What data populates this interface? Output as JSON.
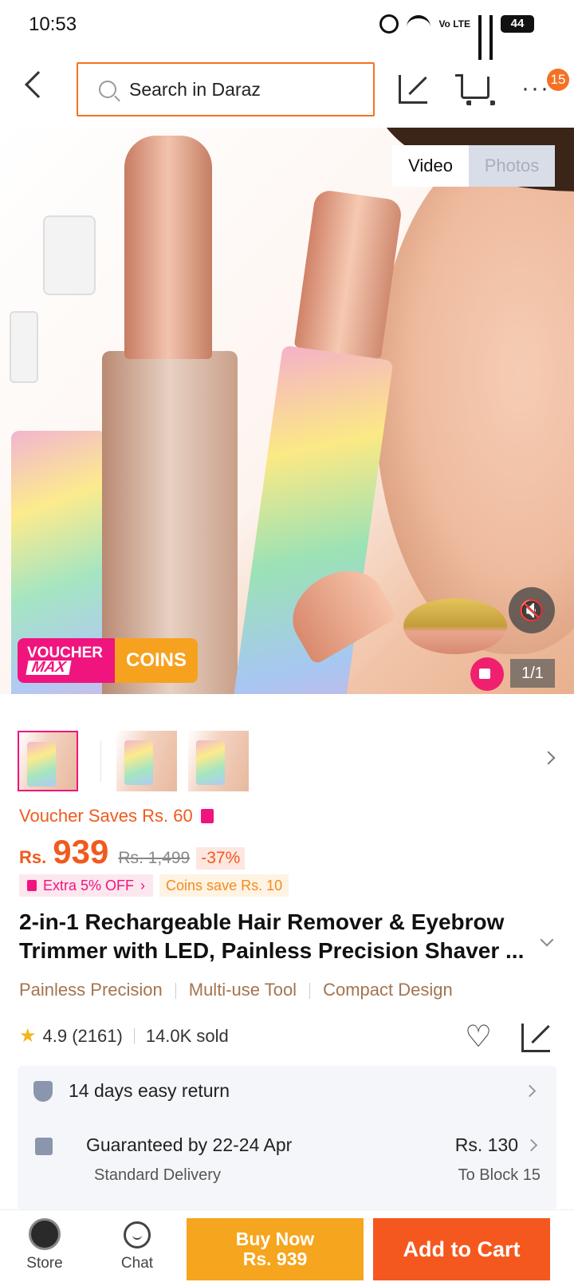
{
  "status_bar": {
    "time": "10:53",
    "volte": "Vo LTE",
    "battery": "44"
  },
  "header": {
    "search_placeholder": "Search in Daraz",
    "cart_badge": "15"
  },
  "gallery": {
    "tabs": [
      "Video",
      "Photos"
    ],
    "active_tab": "Video",
    "voucher_label": "VOUCHER",
    "voucher_max": "MAX",
    "coins_label": "COINS",
    "counter": "1/1",
    "mute_icon": "mute-icon"
  },
  "price": {
    "voucher_saves": "Voucher Saves Rs. 60",
    "currency": "Rs.",
    "current": "939",
    "original": "Rs. 1,499",
    "discount": "-37%",
    "extra_off": "Extra 5% OFF",
    "coins_save": "Coins save Rs. 10"
  },
  "product": {
    "title": "2-in-1 Rechargeable Hair Remover & Eyebrow Trimmer with LED, Painless Precision Shaver ...",
    "tags": [
      "Painless Precision",
      "Multi-use Tool",
      "Compact Design"
    ],
    "rating": "4.9",
    "reviews": "(2161)",
    "sold": "14.0K sold"
  },
  "service": {
    "return_text": "14 days easy return",
    "delivery_text": "Guaranteed by 22-24 Apr",
    "delivery_type": "Standard Delivery",
    "delivery_price": "Rs. 130",
    "delivery_to": "To Block 15"
  },
  "bottom_bar": {
    "store_label": "Store",
    "chat_label": "Chat",
    "buy_now_label": "Buy Now",
    "buy_now_price": "Rs. 939",
    "add_to_cart_label": "Add to Cart"
  },
  "colors": {
    "accent": "#f57224",
    "pink": "#f0147e",
    "buy_now": "#f6a51e",
    "add_cart": "#f5581e"
  }
}
